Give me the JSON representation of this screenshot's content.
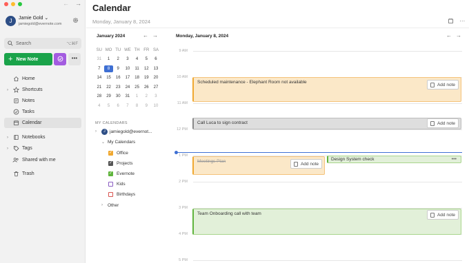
{
  "window": {
    "back_arrow": "←",
    "forward_arrow": "→"
  },
  "account": {
    "initial": "J",
    "name": "Jamie Gold ⌄",
    "email": "jamiegold@evernote.com"
  },
  "search": {
    "placeholder": "Search",
    "shortcut": "⌥⌘F"
  },
  "actions": {
    "new_note": "New Note",
    "more": "•••"
  },
  "nav": {
    "home": "Home",
    "shortcuts": "Shortcuts",
    "notes": "Notes",
    "tasks": "Tasks",
    "calendar": "Calendar",
    "notebooks": "Notebooks",
    "tags": "Tags",
    "shared": "Shared with me",
    "trash": "Trash"
  },
  "header": {
    "title": "Calendar",
    "date": "Monday, January 8, 2024",
    "more": "···"
  },
  "mini_calendar": {
    "month_label": "January 2024",
    "prev": "←",
    "next": "→",
    "weekdays": [
      "SU",
      "MO",
      "TU",
      "WE",
      "TH",
      "FR",
      "SA"
    ],
    "weeks": [
      [
        "31",
        "1",
        "2",
        "3",
        "4",
        "5",
        "6"
      ],
      [
        "7",
        "8",
        "9",
        "10",
        "11",
        "12",
        "13"
      ],
      [
        "14",
        "15",
        "16",
        "17",
        "18",
        "19",
        "20"
      ],
      [
        "21",
        "22",
        "23",
        "24",
        "25",
        "26",
        "27"
      ],
      [
        "28",
        "29",
        "30",
        "31",
        "1",
        "2",
        "3"
      ],
      [
        "4",
        "5",
        "6",
        "7",
        "8",
        "9",
        "10"
      ]
    ]
  },
  "my_calendars": {
    "heading": "MY CALENDARS",
    "account_label": "jamiegold@evernot...",
    "group_label": "My Calendars",
    "items": [
      {
        "label": "Office",
        "color": "#f0a830",
        "checked": true
      },
      {
        "label": "Projects",
        "color": "#555555",
        "checked": true
      },
      {
        "label": "Evernote",
        "color": "#5fb43c",
        "checked": true
      },
      {
        "label": "Kids",
        "color": "#8a5cc2",
        "checked": false
      },
      {
        "label": "Birthdays",
        "color": "#d9534f",
        "checked": false
      }
    ],
    "other_label": "Other"
  },
  "day_view": {
    "date_label": "Monday, January 8, 2024",
    "prev": "←",
    "next": "→",
    "hours": [
      "9 AM",
      "10 AM",
      "11 AM",
      "12 PM",
      "1 PM",
      "2 PM",
      "3 PM",
      "4 PM",
      "5 PM"
    ],
    "add_note_label": "Add note",
    "events": {
      "maintenance": "Scheduled maintenance - Elephant Room not available",
      "luca": "Call Luca to sign contract",
      "meetings": "Meetings Plan",
      "design": "Design System check",
      "onboarding": "Team Onboarding call with team"
    }
  }
}
